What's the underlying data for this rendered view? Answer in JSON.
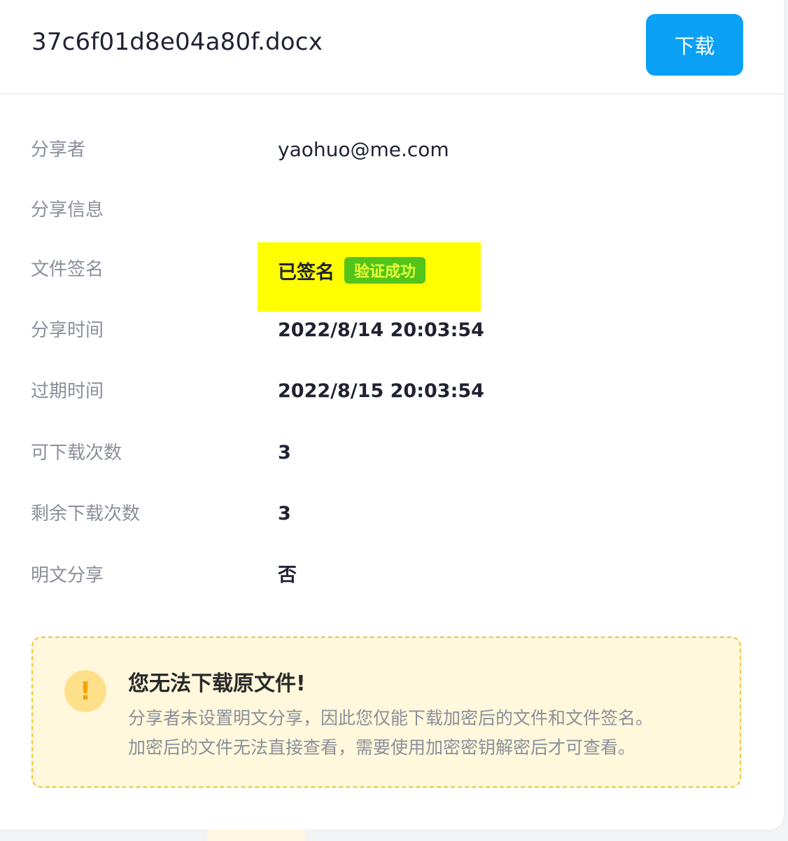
{
  "header": {
    "file_name": "37c6f01d8e04a80f.docx",
    "download_label": "下载"
  },
  "details": {
    "sharer_label": "分享者",
    "sharer_value": "yaohuo@me.com",
    "share_info_label": "分享信息",
    "share_info_value": "",
    "signature_label": "文件签名",
    "signature_value": "已签名",
    "signature_badge": "验证成功",
    "share_time_label": "分享时间",
    "share_time_value": "2022/8/14 20:03:54",
    "expire_time_label": "过期时间",
    "expire_time_value": "2022/8/15 20:03:54",
    "download_count_label": "可下载次数",
    "download_count_value": "3",
    "remaining_label": "剩余下载次数",
    "remaining_value": "3",
    "plaintext_label": "明文分享",
    "plaintext_value": "否"
  },
  "notice": {
    "icon": "exclamation-icon",
    "icon_glyph": "!",
    "title": "您无法下载原文件!",
    "line1": "分享者未设置明文分享，因此您仅能下载加密后的文件和文件签名。",
    "line2": "加密后的文件无法直接查看，需要使用加密密钥解密后才可查看。"
  },
  "colors": {
    "accent": "#0aa0f5",
    "badge_bg": "#52c41a",
    "highlight": "#ffff00",
    "notice_bg": "#fff8dc",
    "notice_border": "#f5c23a"
  }
}
